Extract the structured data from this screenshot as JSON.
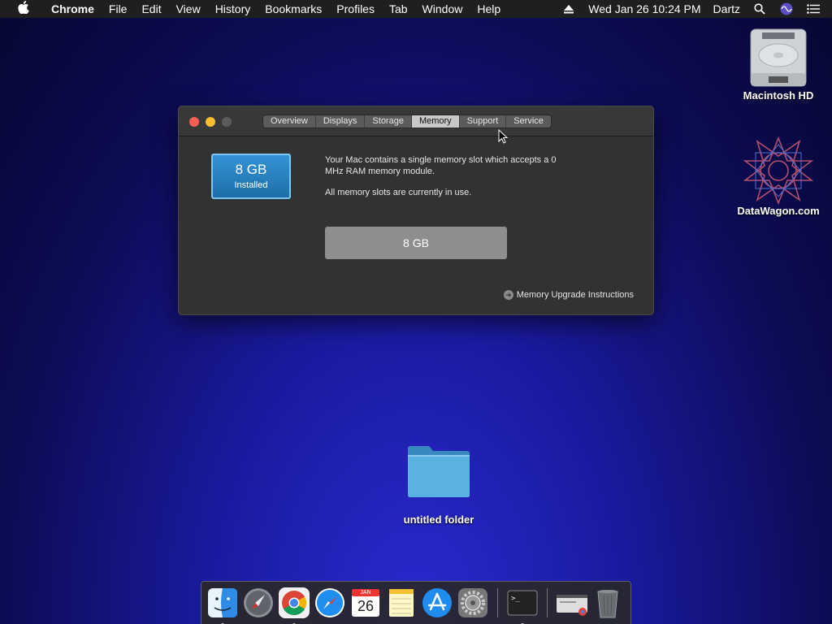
{
  "menubar": {
    "app_name": "Chrome",
    "items": [
      "File",
      "Edit",
      "View",
      "History",
      "Bookmarks",
      "Profiles",
      "Tab",
      "Window",
      "Help"
    ],
    "clock": "Wed Jan 26  10:24 PM",
    "user": "Dartz"
  },
  "desktop": {
    "icons": [
      {
        "label": "Macintosh HD",
        "icon": "hard-drive-icon"
      },
      {
        "label": "DataWagon.com",
        "icon": "geometric-star-icon"
      },
      {
        "label": "untitled folder",
        "icon": "folder-icon"
      }
    ]
  },
  "window": {
    "tabs": [
      "Overview",
      "Displays",
      "Storage",
      "Memory",
      "Support",
      "Service"
    ],
    "active_tab": "Memory",
    "memory_badge": {
      "size": "8 GB",
      "label": "Installed"
    },
    "description_1": "Your Mac contains a single memory slot which accepts a 0 MHz RAM memory module.",
    "description_2": "All memory slots are currently in use.",
    "slot_label": "8 GB",
    "upgrade_link": "Memory Upgrade Instructions"
  },
  "dock": {
    "apps": [
      "Finder",
      "Launchpad",
      "Chrome",
      "Safari",
      "Calendar",
      "Notes",
      "App Store",
      "System Preferences",
      "Terminal"
    ],
    "calendar_day": "26",
    "calendar_month": "JAN"
  },
  "colors": {
    "accent_blue": "#2a84c8",
    "window_bg": "#323232",
    "menubar_bg": "#1f1f1f"
  }
}
